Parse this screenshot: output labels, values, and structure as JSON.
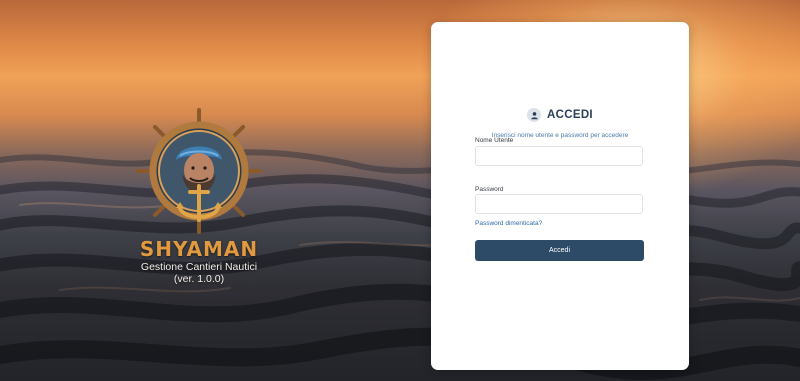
{
  "brand": {
    "name": "SHYAMAN",
    "subtitle": "Gestione Cantieri Nautici",
    "version": "(ver. 1.0.0)",
    "emblem_icon": "sailor-helm-anchor-emblem",
    "accent_color": "#e39a3f"
  },
  "login": {
    "title": "ACCEDI",
    "title_icon": "user-icon",
    "subtitle": "Inserisci nome utente e password per accedere",
    "username_label": "Nome Utente",
    "username_value": "",
    "password_label": "Password",
    "password_value": "",
    "forgot_link": "Password dimenticata?",
    "submit_label": "Accedi",
    "button_color": "#2d4a66"
  }
}
